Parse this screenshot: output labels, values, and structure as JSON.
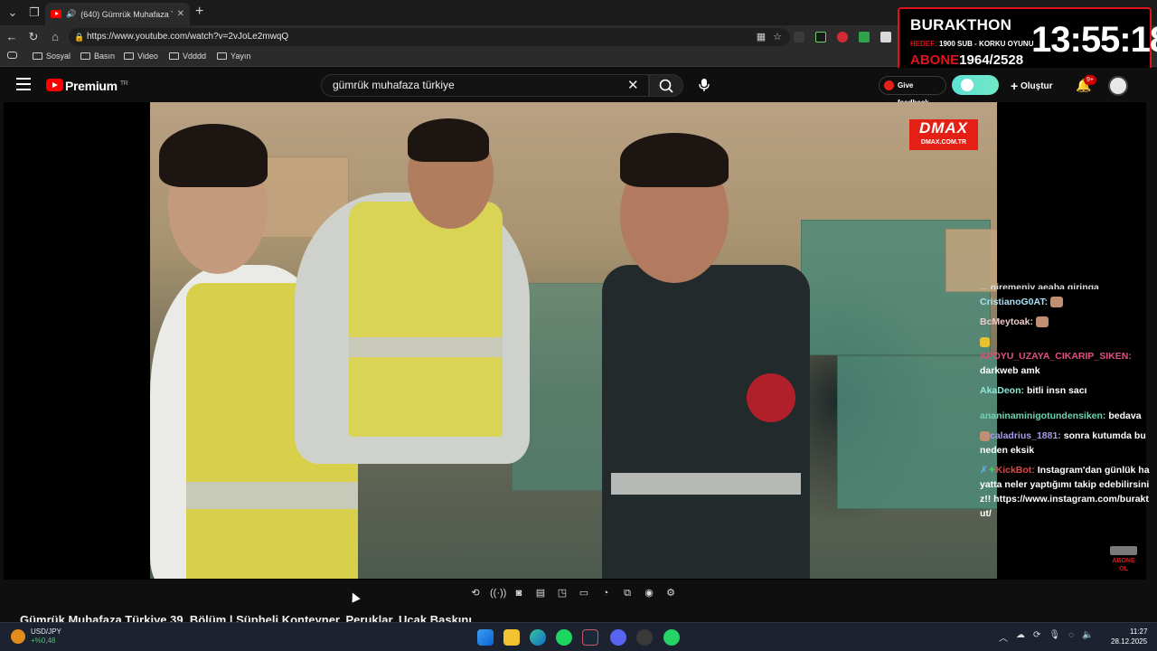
{
  "browser": {
    "tab_title": "(640) Gümrük Muhafaza Türkiye",
    "url": "https://www.youtube.com/watch?v=2vJoLe2mwqQ",
    "bookmarks": [
      "Sosyal",
      "Basın",
      "Video",
      "Vdddd",
      "Yayın"
    ]
  },
  "stream_widget": {
    "name": "BURAKTHON",
    "goal_label": "HEDEF:",
    "goal_text": "1900 SUB - KORKU OYUNU",
    "sub_label": "ABONE",
    "sub_count": "1964/2528",
    "clock": "13:55:18"
  },
  "youtube": {
    "logo_text": "Premium",
    "region": "TR",
    "search_value": "gümrük muhafaza türkiye",
    "feedback_label": "Give feedback",
    "create_label": "Oluştur",
    "notifications_badge": "9+"
  },
  "video": {
    "channel_logo": "DMAX",
    "channel_url": "DMAX.COM.TR",
    "title": "Gümrük Muhafaza Türkiye 39. Bölüm | Şüpheli Konteyner, Peruklar, Uçak Baskını"
  },
  "chat": {
    "messages": [
      {
        "user": "",
        "text": "... giremeniy aeaba giringa",
        "color": "#dddddd"
      },
      {
        "user": "CristianoG0AT:",
        "text": "",
        "color": "#a9e0f4"
      },
      {
        "user": "BcMeytoak:",
        "text": "",
        "color": "#f0c9c9"
      },
      {
        "user": "APOYU_UZAYA_CIKARIP_SIKEN:",
        "text": "darkweb amk",
        "color": "#e0507c"
      },
      {
        "user": "AkaDeon:",
        "text": "bitli insn sacı",
        "color": "#8ee8d6"
      },
      {
        "user": "ananinaminigotundensiken:",
        "text": "bedava",
        "color": "#6fd3b2"
      },
      {
        "user": "caladrius_1881:",
        "text": "sonra kutumda bu neden eksik",
        "color": "#a99be8"
      },
      {
        "user": "KickBot:",
        "text": "Instagram'dan günlük hayatta neler yaptığımı takip edebilirsiniz!! https://www.instagram.com/buraktut/",
        "color": "#e04848"
      }
    ],
    "abone_ol": "ABONE OL"
  },
  "taskbar": {
    "ticker_name": "USD/JPY",
    "ticker_change": "+%0,48",
    "ticker_alert": "5",
    "time": "11:27",
    "date": "28.12.2025"
  },
  "colors": {
    "accent_red": "#e0131a",
    "youtube_red": "#ff0000",
    "dmax_red": "#e31f16"
  }
}
